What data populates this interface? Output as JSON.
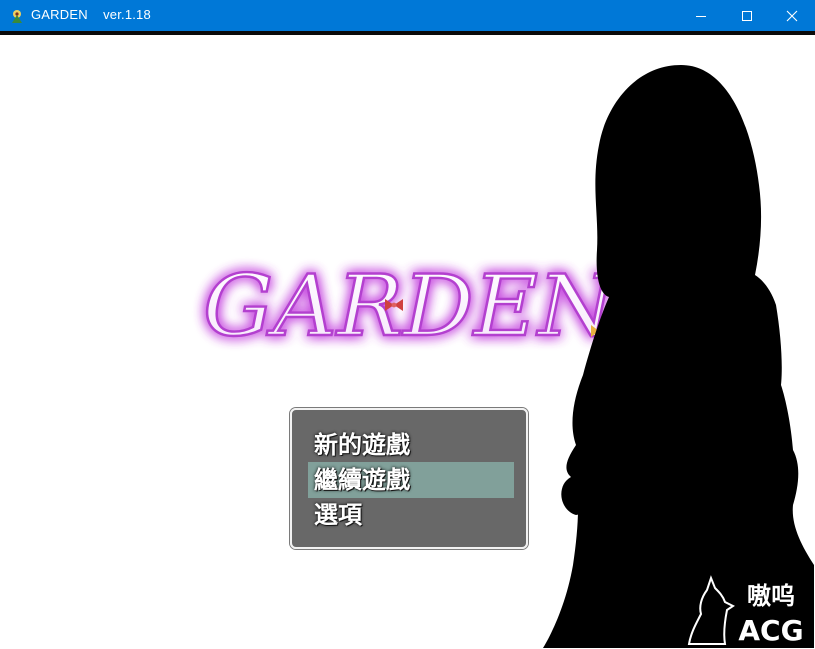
{
  "window": {
    "title": "GARDEN    ver.1.18",
    "icons": {
      "app": "game-app-icon",
      "minimize": "minimize-icon",
      "maximize": "maximize-icon",
      "close": "close-icon"
    },
    "accent_color": "#0078d7"
  },
  "game": {
    "logo_text": "GARDEN",
    "logo_glow_color": "#c850e0",
    "menu": {
      "items": [
        {
          "label": "新的遊戲",
          "selected": false
        },
        {
          "label": "繼續遊戲",
          "selected": true
        },
        {
          "label": "選項",
          "selected": false
        }
      ],
      "highlight_color": "#96cdc3"
    }
  },
  "watermark": {
    "line1": "嗷呜",
    "line2": "ACG",
    "icon": "wolf-howling-icon"
  }
}
